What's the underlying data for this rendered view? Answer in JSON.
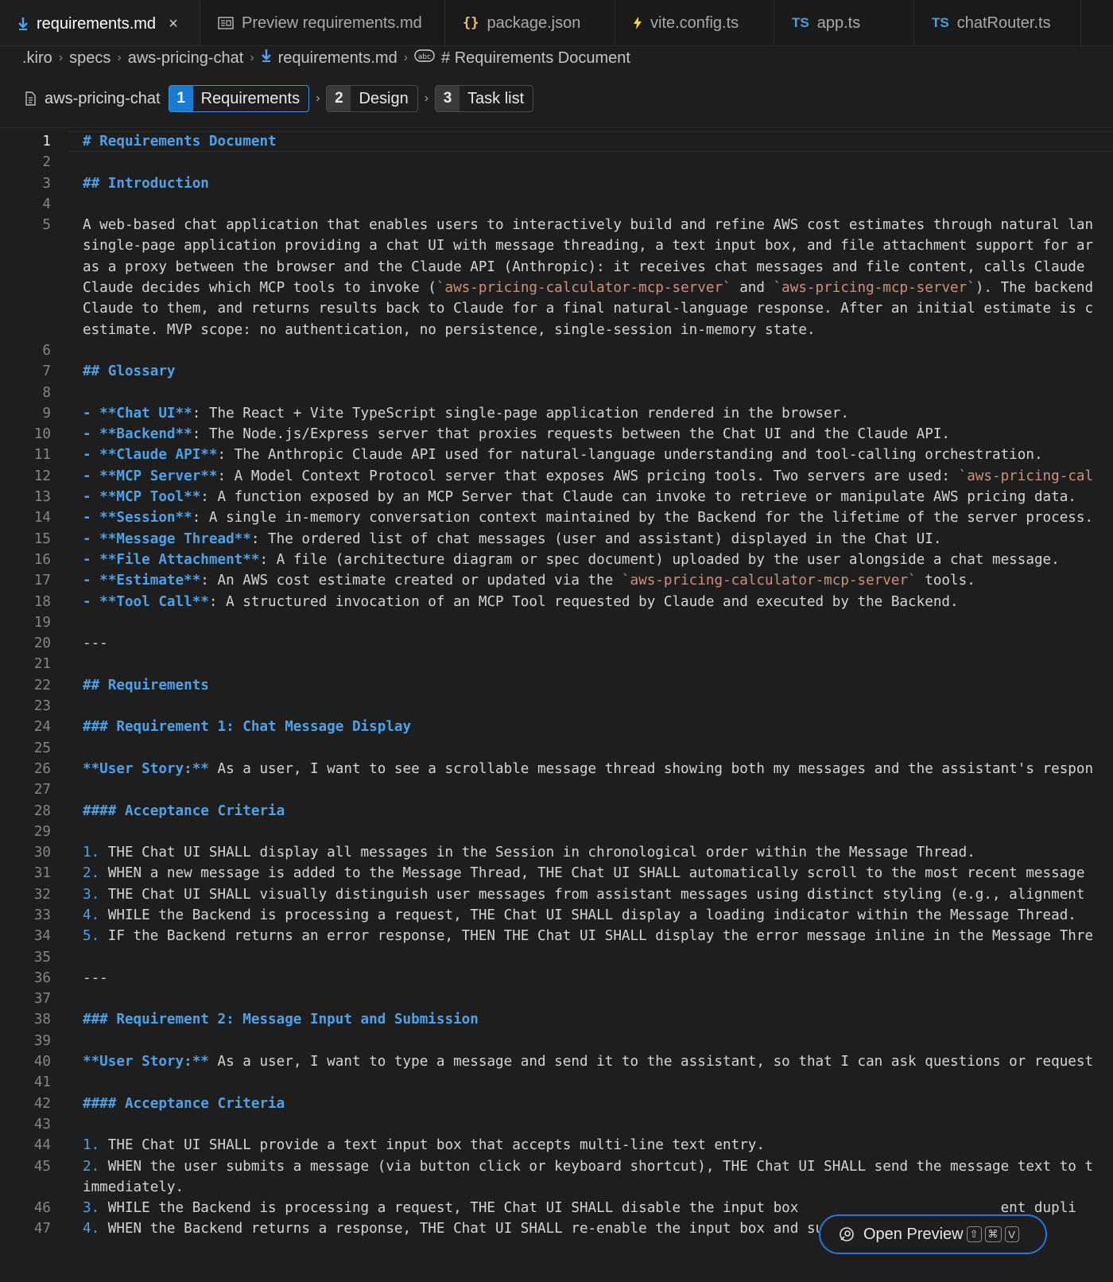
{
  "tabs": [
    {
      "label": "requirements.md",
      "icon": "markdown-icon",
      "active": true,
      "closable": true
    },
    {
      "label": "Preview requirements.md",
      "icon": "preview-icon",
      "active": false
    },
    {
      "label": "package.json",
      "icon": "json-icon",
      "active": false
    },
    {
      "label": "vite.config.ts",
      "icon": "vite-icon",
      "active": false
    },
    {
      "label": "app.ts",
      "icon": "typescript-icon",
      "active": false
    },
    {
      "label": "chatRouter.ts",
      "icon": "typescript-icon",
      "active": false
    }
  ],
  "icons": {
    "json_glyph": "{}",
    "ts_glyph": "TS",
    "close_glyph": "×",
    "chevron_glyph": "›"
  },
  "breadcrumb": [
    ".kiro",
    "specs",
    "aws-pricing-chat",
    "requirements.md",
    "# Requirements Document"
  ],
  "spec": {
    "name": "aws-pricing-chat",
    "steps": [
      {
        "num": "1",
        "label": "Requirements",
        "active": true
      },
      {
        "num": "2",
        "label": "Design",
        "active": false
      },
      {
        "num": "3",
        "label": "Task list",
        "active": false
      }
    ]
  },
  "editor": {
    "current_line": 1,
    "lines": [
      {
        "n": "1",
        "segs": [
          {
            "t": "# Requirements Document",
            "c": "h"
          }
        ]
      },
      {
        "n": "2",
        "segs": []
      },
      {
        "n": "3",
        "segs": [
          {
            "t": "## Introduction",
            "c": "h"
          }
        ]
      },
      {
        "n": "4",
        "segs": []
      },
      {
        "n": "5",
        "segs": [
          {
            "t": "A web-based chat application that enables users to interactively build and refine AWS cost estimates through natural lan",
            "c": ""
          }
        ]
      },
      {
        "n": "",
        "segs": [
          {
            "t": "single-page application providing a chat UI with message threading, a text input box, and file attachment support for ar",
            "c": ""
          }
        ]
      },
      {
        "n": "",
        "segs": [
          {
            "t": "as a proxy between the browser and the Claude API (Anthropic): it receives chat messages and file content, calls Claude",
            "c": ""
          }
        ]
      },
      {
        "n": "",
        "segs": [
          {
            "t": "Claude decides which MCP tools to invoke (",
            "c": ""
          },
          {
            "t": "`aws-pricing-calculator-mcp-server`",
            "c": "c"
          },
          {
            "t": " and ",
            "c": ""
          },
          {
            "t": "`aws-pricing-mcp-server`",
            "c": "c"
          },
          {
            "t": "). The backend",
            "c": ""
          }
        ]
      },
      {
        "n": "",
        "segs": [
          {
            "t": "Claude to them, and returns results back to Claude for a final natural-language response. After an initial estimate is c",
            "c": ""
          }
        ]
      },
      {
        "n": "",
        "segs": [
          {
            "t": "estimate. MVP scope: no authentication, no persistence, single-session in-memory state.",
            "c": ""
          }
        ]
      },
      {
        "n": "6",
        "segs": []
      },
      {
        "n": "7",
        "segs": [
          {
            "t": "## Glossary",
            "c": "h"
          }
        ]
      },
      {
        "n": "8",
        "segs": []
      },
      {
        "n": "9",
        "segs": [
          {
            "t": "- **Chat UI**",
            "c": "b"
          },
          {
            "t": ": The React + Vite TypeScript single-page application rendered in the browser.",
            "c": ""
          }
        ]
      },
      {
        "n": "10",
        "segs": [
          {
            "t": "- **Backend**",
            "c": "b"
          },
          {
            "t": ": The Node.js/Express server that proxies requests between the Chat UI and the Claude API.",
            "c": ""
          }
        ]
      },
      {
        "n": "11",
        "segs": [
          {
            "t": "- **Claude API**",
            "c": "b"
          },
          {
            "t": ": The Anthropic Claude API used for natural-language understanding and tool-calling orchestration.",
            "c": ""
          }
        ]
      },
      {
        "n": "12",
        "segs": [
          {
            "t": "- **MCP Server**",
            "c": "b"
          },
          {
            "t": ": A Model Context Protocol server that exposes AWS pricing tools. Two servers are used: ",
            "c": ""
          },
          {
            "t": "`aws-pricing-cal",
            "c": "c"
          }
        ]
      },
      {
        "n": "13",
        "segs": [
          {
            "t": "- **MCP Tool**",
            "c": "b"
          },
          {
            "t": ": A function exposed by an MCP Server that Claude can invoke to retrieve or manipulate AWS pricing data.",
            "c": ""
          }
        ]
      },
      {
        "n": "14",
        "segs": [
          {
            "t": "- **Session**",
            "c": "b"
          },
          {
            "t": ": A single in-memory conversation context maintained by the Backend for the lifetime of the server process.",
            "c": ""
          }
        ]
      },
      {
        "n": "15",
        "segs": [
          {
            "t": "- **Message Thread**",
            "c": "b"
          },
          {
            "t": ": The ordered list of chat messages (user and assistant) displayed in the Chat UI.",
            "c": ""
          }
        ]
      },
      {
        "n": "16",
        "segs": [
          {
            "t": "- **File Attachment**",
            "c": "b"
          },
          {
            "t": ": A file (architecture diagram or spec document) uploaded by the user alongside a chat message.",
            "c": ""
          }
        ]
      },
      {
        "n": "17",
        "segs": [
          {
            "t": "- **Estimate**",
            "c": "b"
          },
          {
            "t": ": An AWS cost estimate created or updated via the ",
            "c": ""
          },
          {
            "t": "`aws-pricing-calculator-mcp-server`",
            "c": "c"
          },
          {
            "t": " tools.",
            "c": ""
          }
        ]
      },
      {
        "n": "18",
        "segs": [
          {
            "t": "- **Tool Call**",
            "c": "b"
          },
          {
            "t": ": A structured invocation of an MCP Tool requested by Claude and executed by the Backend.",
            "c": ""
          }
        ]
      },
      {
        "n": "19",
        "segs": []
      },
      {
        "n": "20",
        "segs": [
          {
            "t": "---",
            "c": ""
          }
        ]
      },
      {
        "n": "21",
        "segs": []
      },
      {
        "n": "22",
        "segs": [
          {
            "t": "## Requirements",
            "c": "h"
          }
        ]
      },
      {
        "n": "23",
        "segs": []
      },
      {
        "n": "24",
        "segs": [
          {
            "t": "### Requirement 1: Chat Message Display",
            "c": "h"
          }
        ]
      },
      {
        "n": "25",
        "segs": []
      },
      {
        "n": "26",
        "segs": [
          {
            "t": "**User Story:**",
            "c": "b"
          },
          {
            "t": " As a user, I want to see a scrollable message thread showing both my messages and the assistant's respon",
            "c": ""
          }
        ]
      },
      {
        "n": "27",
        "segs": []
      },
      {
        "n": "28",
        "segs": [
          {
            "t": "#### Acceptance Criteria",
            "c": "h"
          }
        ]
      },
      {
        "n": "29",
        "segs": []
      },
      {
        "n": "30",
        "segs": [
          {
            "t": "1.",
            "c": "num-list"
          },
          {
            "t": " THE Chat UI SHALL display all messages in the Session in chronological order within the Message Thread.",
            "c": ""
          }
        ]
      },
      {
        "n": "31",
        "segs": [
          {
            "t": "2.",
            "c": "num-list"
          },
          {
            "t": " WHEN a new message is added to the Message Thread, THE Chat UI SHALL automatically scroll to the most recent message",
            "c": ""
          }
        ]
      },
      {
        "n": "32",
        "segs": [
          {
            "t": "3.",
            "c": "num-list"
          },
          {
            "t": " THE Chat UI SHALL visually distinguish user messages from assistant messages using distinct styling (e.g., alignment",
            "c": ""
          }
        ]
      },
      {
        "n": "33",
        "segs": [
          {
            "t": "4.",
            "c": "num-list"
          },
          {
            "t": " WHILE the Backend is processing a request, THE Chat UI SHALL display a loading indicator within the Message Thread.",
            "c": ""
          }
        ]
      },
      {
        "n": "34",
        "segs": [
          {
            "t": "5.",
            "c": "num-list"
          },
          {
            "t": " IF the Backend returns an error response, THEN THE Chat UI SHALL display the error message inline in the Message Thre",
            "c": ""
          }
        ]
      },
      {
        "n": "35",
        "segs": []
      },
      {
        "n": "36",
        "segs": [
          {
            "t": "---",
            "c": ""
          }
        ]
      },
      {
        "n": "37",
        "segs": []
      },
      {
        "n": "38",
        "segs": [
          {
            "t": "### Requirement 2: Message Input and Submission",
            "c": "h"
          }
        ]
      },
      {
        "n": "39",
        "segs": []
      },
      {
        "n": "40",
        "segs": [
          {
            "t": "**User Story:**",
            "c": "b"
          },
          {
            "t": " As a user, I want to type a message and send it to the assistant, so that I can ask questions or request",
            "c": ""
          }
        ]
      },
      {
        "n": "41",
        "segs": []
      },
      {
        "n": "42",
        "segs": [
          {
            "t": "#### Acceptance Criteria",
            "c": "h"
          }
        ]
      },
      {
        "n": "43",
        "segs": []
      },
      {
        "n": "44",
        "segs": [
          {
            "t": "1.",
            "c": "num-list"
          },
          {
            "t": " THE Chat UI SHALL provide a text input box that accepts multi-line text entry.",
            "c": ""
          }
        ]
      },
      {
        "n": "45",
        "segs": [
          {
            "t": "2.",
            "c": "num-list"
          },
          {
            "t": " WHEN the user submits a message (via button click or keyboard shortcut), THE Chat UI SHALL send the message text to t",
            "c": ""
          }
        ]
      },
      {
        "n": "",
        "segs": [
          {
            "t": "immediately.",
            "c": ""
          }
        ]
      },
      {
        "n": "46",
        "segs": [
          {
            "t": "3.",
            "c": "num-list"
          },
          {
            "t": " WHILE the Backend is processing a request, THE Chat UI SHALL disable the input box                        ent dupli",
            "c": ""
          }
        ]
      },
      {
        "n": "47",
        "segs": [
          {
            "t": "4.",
            "c": "num-list"
          },
          {
            "t": " WHEN the Backend returns a response, THE Chat UI SHALL re-enable the input box and submit button.",
            "c": ""
          }
        ]
      }
    ]
  },
  "preview_button": {
    "label": "Open Preview",
    "shortcut": [
      "⇧",
      "⌘",
      "V"
    ]
  }
}
